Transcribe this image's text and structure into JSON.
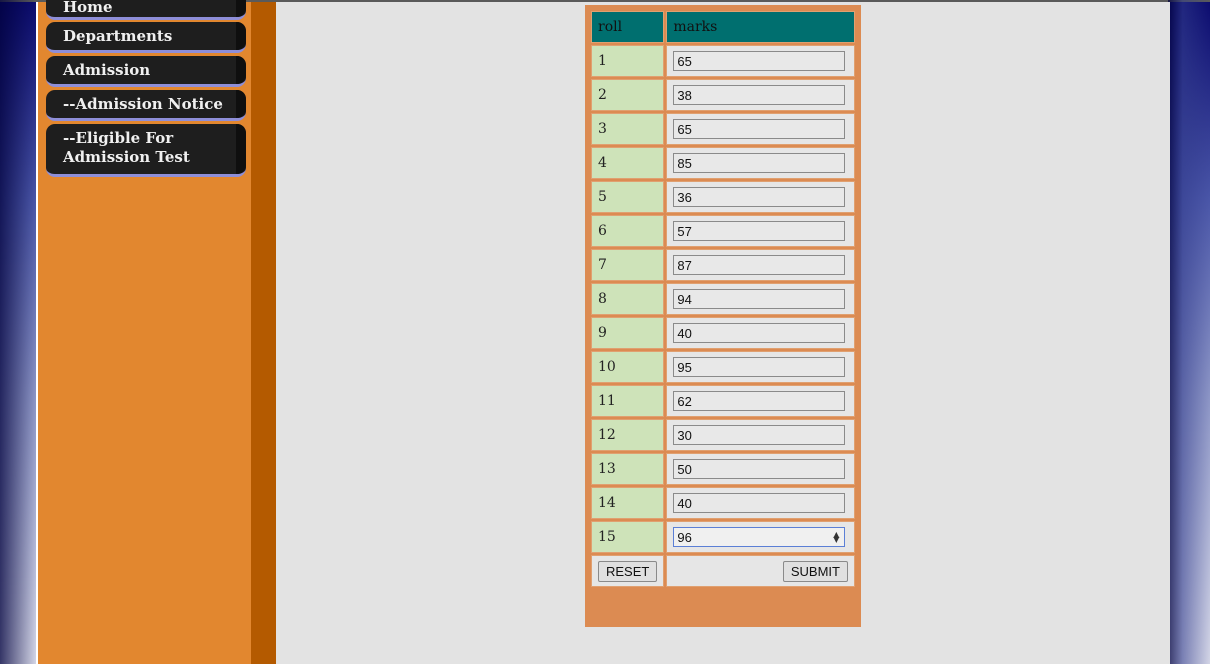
{
  "sidebar": {
    "items": [
      {
        "label": "Home"
      },
      {
        "label": "Departments"
      },
      {
        "label": "Admission"
      },
      {
        "label": "--Admission Notice"
      },
      {
        "label": "--Eligible For Admission Test"
      }
    ]
  },
  "table": {
    "headers": {
      "roll": "roll",
      "marks": "marks"
    },
    "rows": [
      {
        "roll": "1",
        "marks": "65"
      },
      {
        "roll": "2",
        "marks": "38"
      },
      {
        "roll": "3",
        "marks": "65"
      },
      {
        "roll": "4",
        "marks": "85"
      },
      {
        "roll": "5",
        "marks": "36"
      },
      {
        "roll": "6",
        "marks": "57"
      },
      {
        "roll": "7",
        "marks": "87"
      },
      {
        "roll": "8",
        "marks": "94"
      },
      {
        "roll": "9",
        "marks": "40"
      },
      {
        "roll": "10",
        "marks": "95"
      },
      {
        "roll": "11",
        "marks": "62"
      },
      {
        "roll": "12",
        "marks": "30"
      },
      {
        "roll": "13",
        "marks": "50"
      },
      {
        "roll": "14",
        "marks": "40"
      },
      {
        "roll": "15",
        "marks": "96"
      }
    ],
    "reset_label": "RESET",
    "submit_label": "SUBMIT"
  },
  "colors": {
    "sidebar": "#e2872f",
    "sidebar_strip": "#b45a00",
    "header_bg": "#006f6f",
    "roll_bg": "#cee3b9",
    "table_border": "#dc8b52",
    "menu_bg": "#1e1e1e",
    "menu_underline": "#8e8ed8"
  }
}
